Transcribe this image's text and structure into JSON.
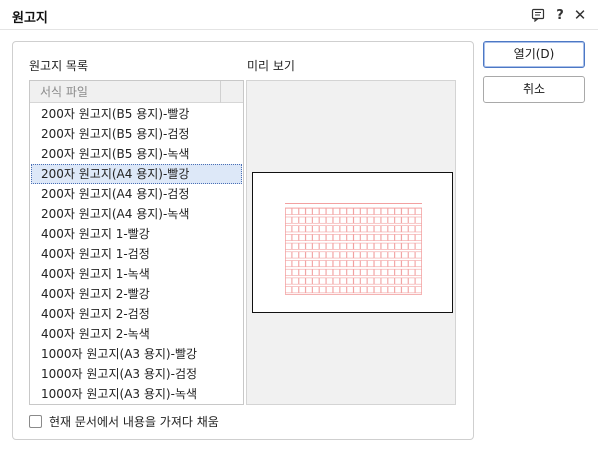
{
  "window": {
    "title": "원고지"
  },
  "titlebar": {
    "help_label": "?",
    "close_label": "✕"
  },
  "list": {
    "label": "원고지 목록",
    "header": "서식 파일",
    "items": [
      "200자 원고지(B5 용지)-빨강",
      "200자 원고지(B5 용지)-검정",
      "200자 원고지(B5 용지)-녹색",
      "200자 원고지(A4 용지)-빨강",
      "200자 원고지(A4 용지)-검정",
      "200자 원고지(A4 용지)-녹색",
      "400자 원고지 1-빨강",
      "400자 원고지 1-검정",
      "400자 원고지 1-녹색",
      "400자 원고지 2-빨강",
      "400자 원고지 2-검정",
      "400자 원고지 2-녹색",
      "1000자 원고지(A3 용지)-빨강",
      "1000자 원고지(A3 용지)-검정",
      "1000자 원고지(A3 용지)-녹색"
    ],
    "selected_index": 3
  },
  "preview": {
    "label": "미리 보기",
    "grid_color": "#f2a0a0"
  },
  "options": {
    "fill_from_doc_label": "현재 문서에서 내용을 가져다 채움",
    "fill_from_doc_checked": false
  },
  "buttons": {
    "open_label": "열기(D)",
    "cancel_label": "취소"
  },
  "colors": {
    "accent": "#4d78c4",
    "selection_bg": "#dde8f8"
  }
}
